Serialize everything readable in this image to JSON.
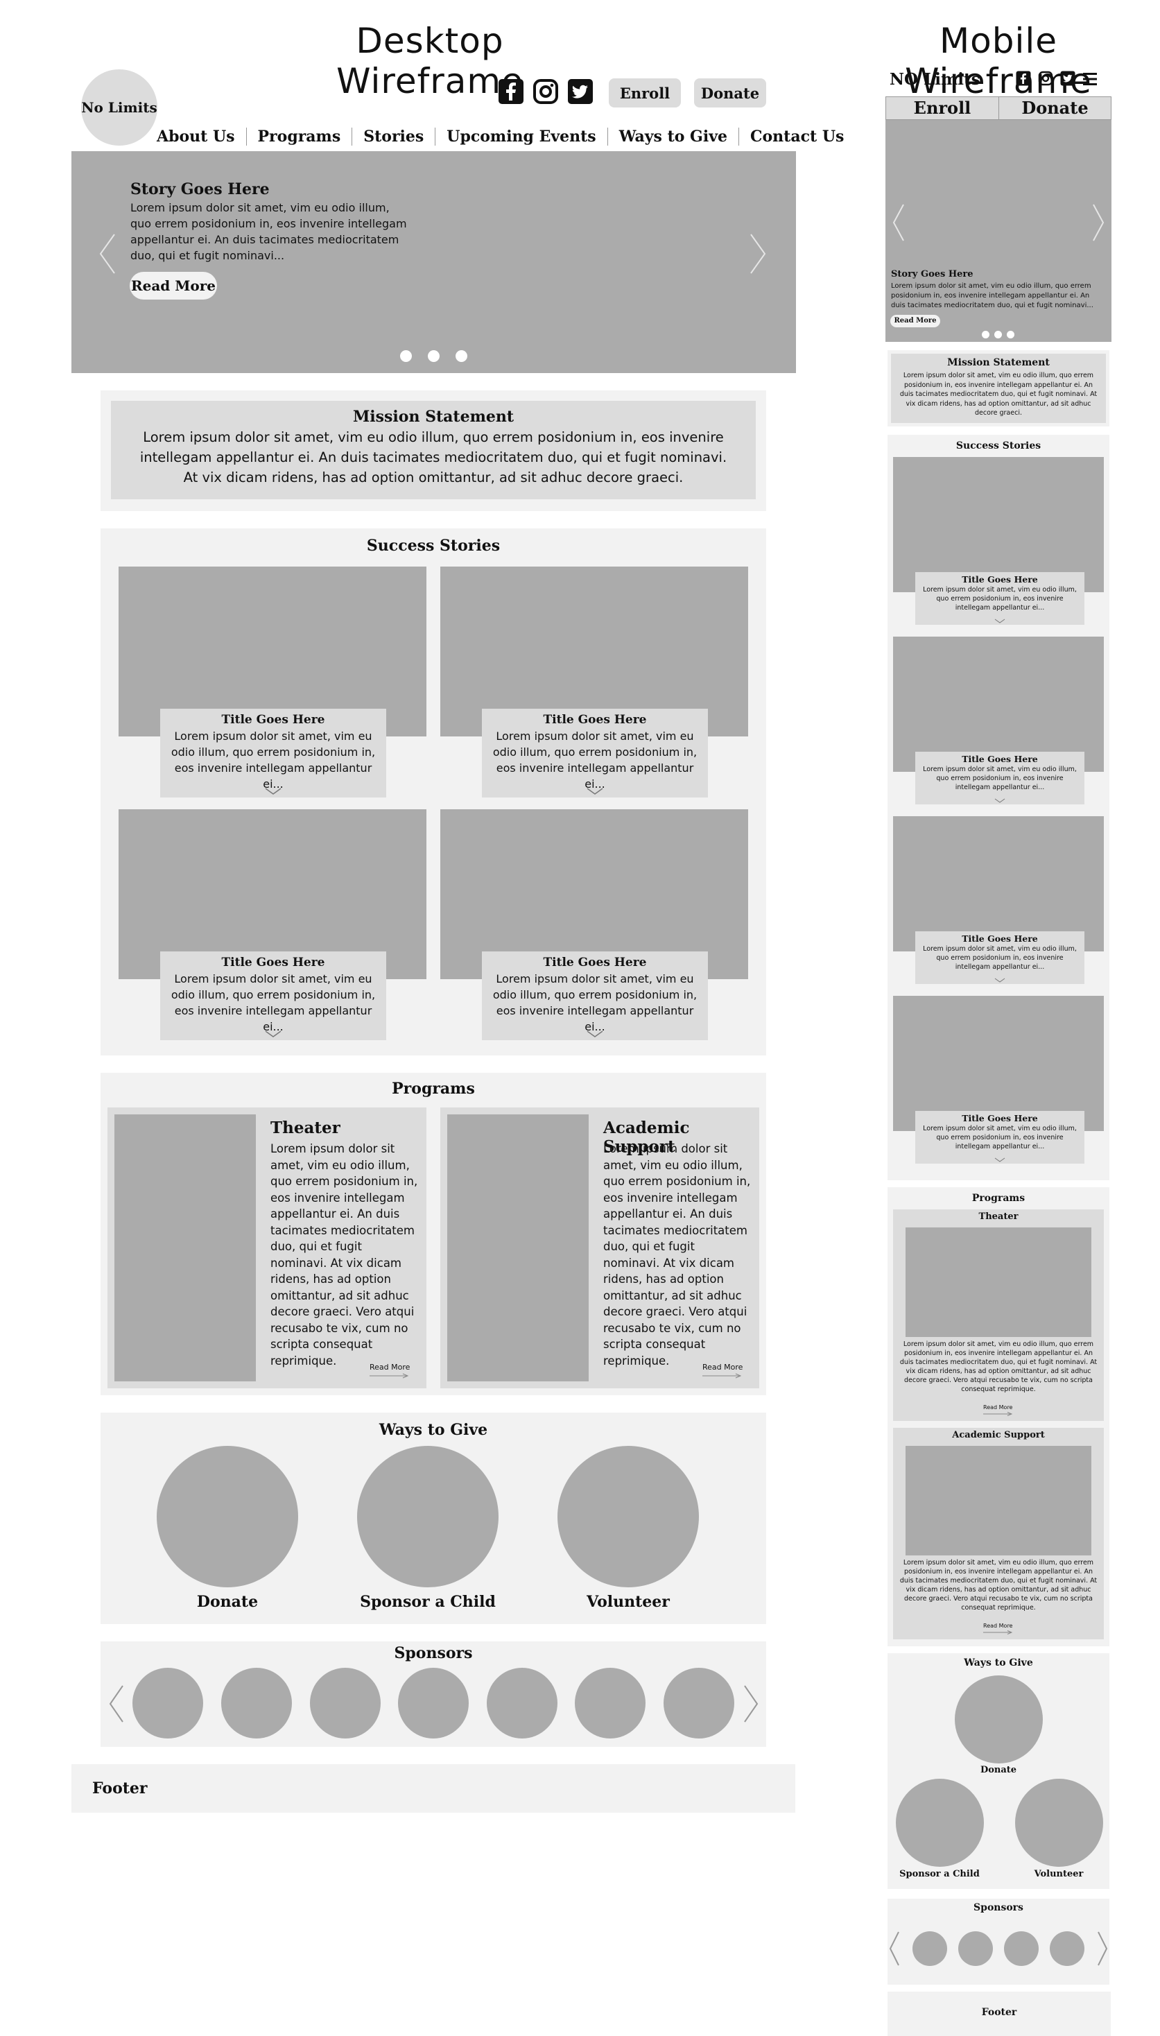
{
  "desktop": {
    "title": "Desktop Wireframe",
    "logo_text": "No Limits",
    "social_icons": [
      "facebook-icon",
      "instagram-icon",
      "twitter-icon"
    ],
    "header_buttons": {
      "enroll": "Enroll",
      "donate": "Donate"
    },
    "nav": [
      "About Us",
      "Programs",
      "Stories",
      "Upcoming Events",
      "Ways to Give",
      "Contact Us"
    ],
    "hero": {
      "title": "Story Goes Here",
      "text": "Lorem ipsum dolor sit amet, vim eu odio illum, quo errem posidonium in, eos invenire intellegam appellantur ei. An duis tacimates mediocritatem duo, qui et fugit nominavi...",
      "button": "Read More",
      "slide_count": 3
    },
    "mission": {
      "title": "Mission Statement",
      "text": "Lorem ipsum dolor sit amet, vim eu odio illum, quo errem posidonium in, eos invenire intellegam appellantur ei. An duis tacimates mediocritatem duo, qui et fugit nominavi. At vix dicam ridens, has ad option omittantur, ad sit adhuc decore graeci."
    },
    "stories": {
      "title": "Success Stories",
      "cards": [
        {
          "title": "Title Goes Here",
          "text": "Lorem ipsum dolor sit amet, vim eu odio illum, quo errem posidonium in, eos invenire intellegam appellantur ei..."
        },
        {
          "title": "Title Goes Here",
          "text": "Lorem ipsum dolor sit amet, vim eu odio illum, quo errem posidonium in, eos invenire intellegam appellantur ei..."
        },
        {
          "title": "Title Goes Here",
          "text": "Lorem ipsum dolor sit amet, vim eu odio illum, quo errem posidonium in, eos invenire intellegam appellantur ei..."
        },
        {
          "title": "Title Goes Here",
          "text": "Lorem ipsum dolor sit amet, vim eu odio illum, quo errem posidonium in, eos invenire intellegam appellantur ei..."
        }
      ]
    },
    "programs": {
      "title": "Programs",
      "items": [
        {
          "name": "Theater",
          "text": "Lorem ipsum dolor sit amet, vim eu odio illum, quo errem posidonium in, eos invenire intellegam appellantur ei. An duis tacimates mediocritatem duo, qui et fugit nominavi. At vix dicam ridens, has ad option omittantur, ad sit adhuc decore graeci. Vero atqui recusabo te vix, cum no scripta consequat reprimique.",
          "read_more": "Read More"
        },
        {
          "name": "Academic Support",
          "text": "Lorem ipsum dolor sit amet, vim eu odio illum, quo errem posidonium in, eos invenire intellegam appellantur ei. An duis tacimates mediocritatem duo, qui et fugit nominavi. At vix dicam ridens, has ad option omittantur, ad sit adhuc decore graeci. Vero atqui recusabo te vix, cum no scripta consequat reprimique.",
          "read_more": "Read More"
        }
      ]
    },
    "ways": {
      "title": "Ways to Give",
      "items": [
        "Donate",
        "Sponsor a Child",
        "Volunteer"
      ]
    },
    "sponsors": {
      "title": "Sponsors",
      "count": 7
    },
    "footer": "Footer"
  },
  "mobile": {
    "title": "Mobile Wireframe",
    "logo_text": "NO Limits",
    "social_icons": [
      "facebook-icon",
      "instagram-icon",
      "twitter-icon",
      "hamburger-menu-icon"
    ],
    "buttons": {
      "enroll": "Enroll",
      "donate": "Donate"
    },
    "hero": {
      "title": "Story Goes Here",
      "text": "Lorem ipsum dolor sit amet, vim eu odio illum, quo errem posidonium in, eos invenire intellegam appellantur ei. An duis tacimates mediocritatem duo, qui et fugit nominavi...",
      "button": "Read More"
    },
    "mission": {
      "title": "Mission Statement",
      "text": "Lorem ipsum dolor sit amet, vim eu odio illum, quo errem posidonium in, eos invenire intellegam appellantur ei. An duis tacimates mediocritatem duo, qui et fugit nominavi. At vix dicam ridens, has ad option omittantur, ad sit adhuc decore graeci."
    },
    "stories": {
      "title": "Success Stories",
      "cards": [
        {
          "title": "Title Goes Here",
          "text": "Lorem ipsum dolor sit amet, vim eu odio illum, quo errem posidonium in, eos invenire intellegam appellantur ei..."
        },
        {
          "title": "Title Goes Here",
          "text": "Lorem ipsum dolor sit amet, vim eu odio illum, quo errem posidonium in, eos invenire intellegam appellantur ei..."
        },
        {
          "title": "Title Goes Here",
          "text": "Lorem ipsum dolor sit amet, vim eu odio illum, quo errem posidonium in, eos invenire intellegam appellantur ei..."
        },
        {
          "title": "Title Goes Here",
          "text": "Lorem ipsum dolor sit amet, vim eu odio illum, quo errem posidonium in, eos invenire intellegam appellantur ei..."
        }
      ]
    },
    "programs": {
      "title": "Programs",
      "items": [
        {
          "name": "Theater",
          "text": "Lorem ipsum dolor sit amet, vim eu odio illum, quo errem posidonium in, eos invenire intellegam appellantur ei. An duis tacimates mediocritatem duo, qui et fugit nominavi. At vix dicam ridens, has ad option omittantur, ad sit adhuc decore graeci. Vero atqui recusabo te vix, cum no scripta consequat reprimique.",
          "read_more": "Read More"
        },
        {
          "name": "Academic Support",
          "text": "Lorem ipsum dolor sit amet, vim eu odio illum, quo errem posidonium in, eos invenire intellegam appellantur ei. An duis tacimates mediocritatem duo, qui et fugit nominavi. At vix dicam ridens, has ad option omittantur, ad sit adhuc decore graeci. Vero atqui recusabo te vix, cum no scripta consequat reprimique.",
          "read_more": "Read More"
        }
      ]
    },
    "ways": {
      "title": "Ways to Give",
      "items": [
        "Donate",
        "Sponsor a Child",
        "Volunteer"
      ]
    },
    "sponsors": {
      "title": "Sponsors",
      "count": 4
    },
    "footer": "Footer"
  },
  "colors": {
    "light_panel": "#f2f2f2",
    "mid_panel": "#dcdcdc",
    "image_placeholder": "#ababab",
    "text": "#111111"
  }
}
